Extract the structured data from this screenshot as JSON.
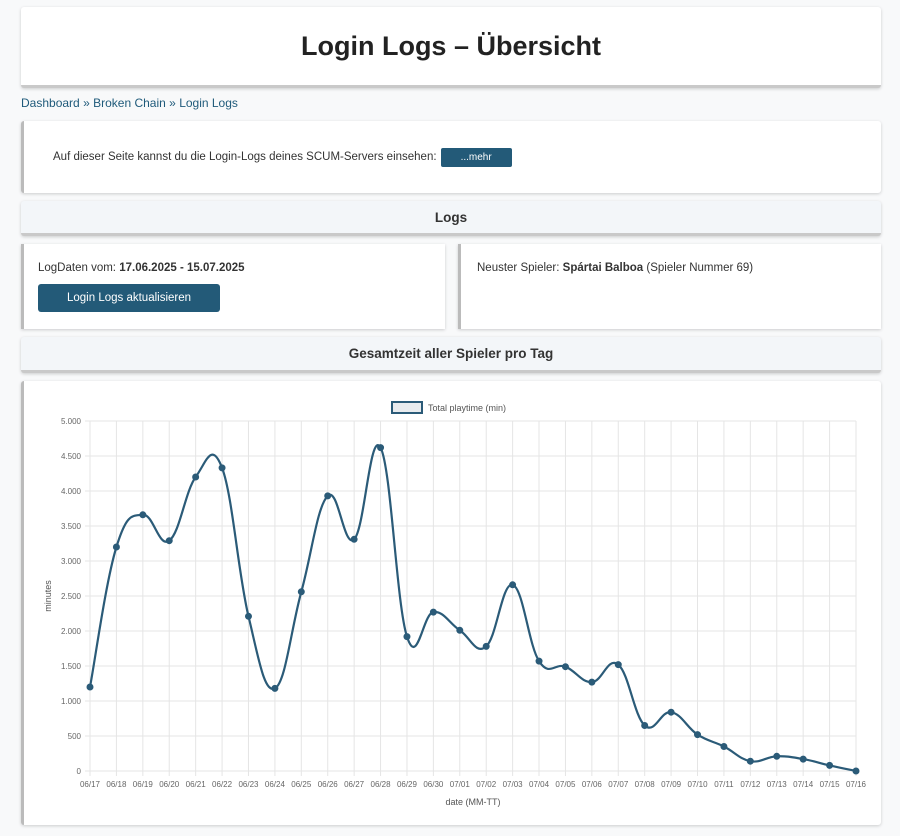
{
  "page": {
    "title": "Login Logs – Übersicht"
  },
  "breadcrumb": {
    "items": [
      "Dashboard",
      "Broken Chain",
      "Login Logs"
    ],
    "separator": "»"
  },
  "info": {
    "text": "Auf dieser Seite kannst du die Login-Logs deines SCUM-Servers einsehen:",
    "more_button": "...mehr"
  },
  "logs_section": {
    "title": "Logs"
  },
  "log_range": {
    "label": "LogDaten vom:",
    "value": "17.06.2025 - 15.07.2025",
    "refresh_button": "Login Logs aktualisieren"
  },
  "newest_player": {
    "label": "Neuster Spieler:",
    "name": "Spártai Balboa",
    "suffix": "(Spieler Nummer 69)"
  },
  "chart_section": {
    "title": "Gesamtzeit aller Spieler pro Tag"
  },
  "colors": {
    "accent": "#235a78",
    "line": "#2b5b78",
    "grid": "#e5e5e5"
  },
  "chart_data": {
    "type": "line",
    "series": [
      {
        "name": "Total playtime (min)",
        "values": [
          1200,
          3200,
          3660,
          3290,
          4200,
          4330,
          2210,
          1180,
          2560,
          3930,
          3310,
          4620,
          1920,
          2270,
          2010,
          1780,
          2660,
          1570,
          1490,
          1270,
          1520,
          650,
          840,
          520,
          350,
          140,
          210,
          170,
          80,
          0
        ]
      }
    ],
    "categories": [
      "06/17",
      "06/18",
      "06/19",
      "06/20",
      "06/21",
      "06/22",
      "06/23",
      "06/24",
      "06/25",
      "06/26",
      "06/27",
      "06/28",
      "06/29",
      "06/30",
      "07/01",
      "07/02",
      "07/03",
      "07/04",
      "07/05",
      "07/06",
      "07/07",
      "07/08",
      "07/09",
      "07/10",
      "07/11",
      "07/12",
      "07/13",
      "07/14",
      "07/15",
      "07/16"
    ],
    "xlabel": "date (MM-TT)",
    "ylabel": "minutes",
    "ylim": [
      0,
      5000
    ],
    "yticks": [
      "0",
      "500",
      "1.000",
      "1.500",
      "2.000",
      "2.500",
      "3.000",
      "3.500",
      "4.000",
      "4.500",
      "5.000"
    ],
    "grid": true,
    "legend": "top-center"
  }
}
